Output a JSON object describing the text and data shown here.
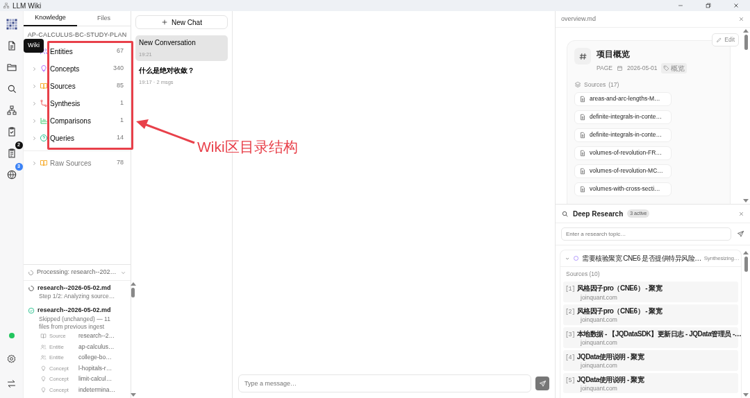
{
  "window": {
    "title": "LLM Wiki"
  },
  "rail": {
    "items": [
      {
        "kind": "logo"
      },
      {
        "kind": "document",
        "tooltip": "Wiki"
      },
      {
        "kind": "folder"
      },
      {
        "kind": "search"
      },
      {
        "kind": "graph"
      },
      {
        "kind": "check"
      },
      {
        "kind": "list",
        "badge": "2",
        "color": "#111111"
      },
      {
        "kind": "globe",
        "badge": "3",
        "color": "#3b82f6"
      }
    ],
    "online": true
  },
  "left_panel": {
    "tabs": [
      {
        "label": "Knowledge",
        "selected": true
      },
      {
        "label": "Files",
        "selected": false
      }
    ],
    "project": "AP-CALCULUS-BC-STUDY-PLAN",
    "categories": [
      {
        "kind": "entity",
        "label": "Entities",
        "count": "67"
      },
      {
        "kind": "concept",
        "label": "Concepts",
        "count": "340"
      },
      {
        "kind": "source",
        "label": "Sources",
        "count": "85"
      },
      {
        "kind": "synthesis",
        "label": "Synthesis",
        "count": "1"
      },
      {
        "kind": "comparison",
        "label": "Comparisons",
        "count": "1"
      },
      {
        "kind": "query",
        "label": "Queries",
        "count": "14"
      }
    ],
    "raw_sources": {
      "kind": "source",
      "label": "Raw Sources",
      "count": "78"
    },
    "processing": {
      "header": "Processing: research--202…",
      "expanded": true,
      "items": [
        {
          "done": false,
          "file": "research--2026-05-02.md",
          "detail": "Step 1/2: Analyzing source…"
        },
        {
          "done": true,
          "file": "research--2026-05-02.md",
          "detail": "Skipped (unchanged) — 11 files from previous ingest",
          "entries": [
            {
              "kind": "source",
              "type": "Source",
              "name": "research--2…"
            },
            {
              "kind": "entity",
              "type": "Entitie",
              "name": "ap-calculus…"
            },
            {
              "kind": "entity",
              "type": "Entitie",
              "name": "college-bo…"
            },
            {
              "kind": "concept",
              "type": "Concept",
              "name": "l-hopitals-r…"
            },
            {
              "kind": "concept",
              "type": "Concept",
              "name": "limit-calcul…"
            },
            {
              "kind": "concept",
              "type": "Concept",
              "name": "indetermina…"
            }
          ]
        }
      ]
    }
  },
  "chats": {
    "new_chat": "New Chat",
    "conversations": [
      {
        "title": "New Conversation",
        "meta": "19:21",
        "selected": true
      },
      {
        "title": "什么是绝对收敛？",
        "meta": "19:17 · 2 msgs",
        "selected": false
      }
    ]
  },
  "composer": {
    "placeholder": "Type a message…"
  },
  "overview": {
    "file": "overview.md",
    "edit": "Edit",
    "title": "项目概览",
    "type": "PAGE",
    "date": "2026-05-01",
    "tag": "概览",
    "sources_label": "Sources",
    "sources_count": "(17)",
    "sources": [
      "areas-and-arc-lengths-M…",
      "definite-integrals-in-conte…",
      "definite-integrals-in-conte…",
      "volumes-of-revolution-FR…",
      "volumes-of-revolution-MC…",
      "volumes-with-cross-secti…"
    ]
  },
  "research": {
    "title": "Deep Research",
    "badge": "3 active",
    "placeholder": "Enter a research topic…",
    "task": {
      "expanded": true,
      "title": "需要核验聚宽 CNE6 是否提供特异风险…",
      "status": "Synthesizing…",
      "sources_label": "Sources (10)",
      "sources": [
        {
          "index": "[1]",
          "title": "风格因子pro（CNE6） - 聚宽",
          "domain": "joinquant.com"
        },
        {
          "index": "[2]",
          "title": "风格因子pro（CNE6） - 聚宽",
          "domain": "joinquant.com"
        },
        {
          "index": "[3]",
          "title": "本地数据 - 【JQDataSDK】更新日志 - JQData管理员 -…",
          "domain": "joinquant.com"
        },
        {
          "index": "[4]",
          "title": "JQData使用说明 - 聚宽",
          "domain": "joinquant.com"
        },
        {
          "index": "[5]",
          "title": "JQData使用说明 - 聚宽",
          "domain": "joinquant.com"
        }
      ]
    }
  },
  "annotation": {
    "label": "Wiki区目录结构"
  }
}
